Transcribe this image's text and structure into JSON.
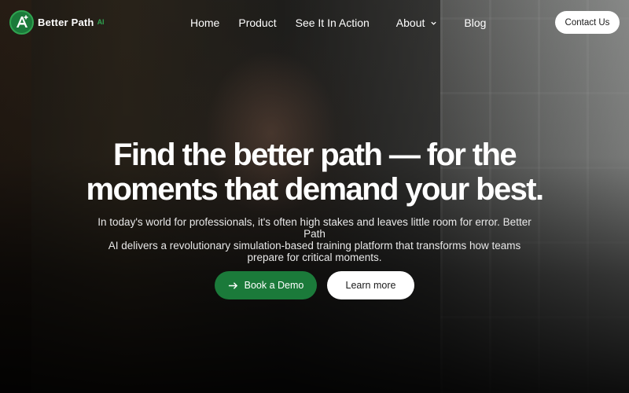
{
  "brand": {
    "name": "Better Path",
    "suffix": "AI",
    "logo_icon": "letter-a-plus-logo",
    "color_primary": "#1b7a3a",
    "color_accent": "#2fa350"
  },
  "nav": {
    "items": [
      {
        "label": "Home"
      },
      {
        "label": "Product"
      },
      {
        "label": "See It In Action"
      },
      {
        "label": "About",
        "has_dropdown": true,
        "icon": "chevron-down-icon"
      },
      {
        "label": "Blog"
      }
    ],
    "contact_label": "Contact Us"
  },
  "hero": {
    "headline_line1": "Find the better path — for the",
    "headline_line2": "moments that demand your best.",
    "subtext_line1": "In today's world for professionals, it's often high stakes and leaves little room for error. Better Path",
    "subtext_line2": "AI delivers a revolutionary simulation-based training platform that transforms how teams",
    "subtext_line3": "prepare for critical moments.",
    "primary_cta": {
      "label": "Book a Demo",
      "icon": "arrow-right-icon"
    },
    "secondary_cta": {
      "label": "Learn more"
    }
  }
}
